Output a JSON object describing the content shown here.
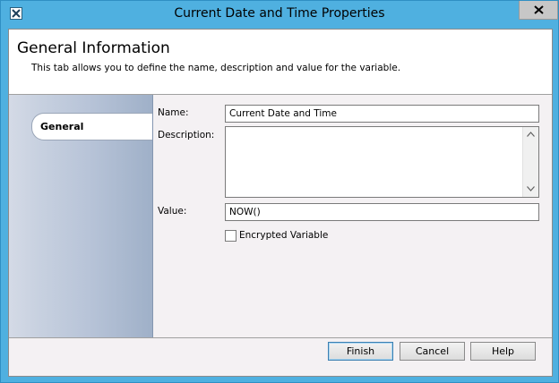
{
  "window": {
    "title": "Current Date and Time Properties"
  },
  "header": {
    "title": "General Information",
    "subtitle": "This tab allows you to define the name, description and value for the variable."
  },
  "sidebar": {
    "tabs": [
      {
        "label": "General"
      }
    ]
  },
  "form": {
    "name_label": "Name:",
    "name_value": "Current Date and Time",
    "description_label": "Description:",
    "description_value": "",
    "value_label": "Value:",
    "value_value": "NOW()",
    "encrypted_label": "Encrypted Variable",
    "encrypted_checked": false
  },
  "buttons": {
    "finish": "Finish",
    "cancel": "Cancel",
    "help": "Help"
  },
  "icons": {
    "app": "variable-app-icon",
    "close": "close-icon",
    "scroll_up": "chevron-up-icon",
    "scroll_down": "chevron-down-icon"
  },
  "colors": {
    "titlebar": "#4fb0e0",
    "client_bg": "#f4f1f3",
    "default_button_border": "#3c7fb1"
  }
}
